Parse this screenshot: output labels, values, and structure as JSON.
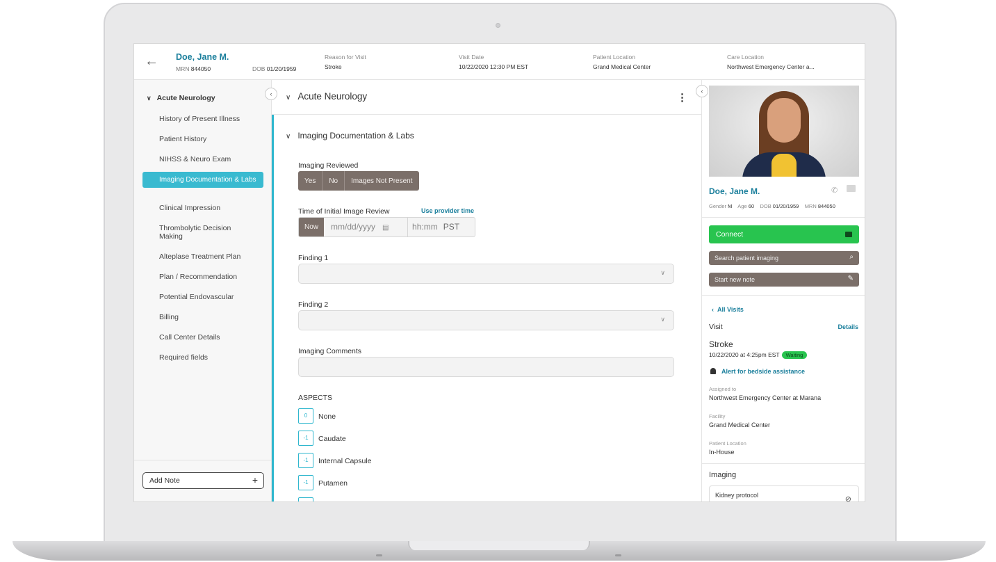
{
  "header": {
    "patient_name": "Doe, Jane M.",
    "mrn_label": "MRN",
    "mrn_value": "844050",
    "dob_label": "DOB",
    "dob_value": "01/20/1959",
    "reason_label": "Reason for Visit",
    "reason_value": "Stroke",
    "visit_date_label": "Visit Date",
    "visit_date_value": "10/22/2020 12:30 PM EST",
    "patient_location_label": "Patient Location",
    "patient_location_value": "Grand Medical Center",
    "care_location_label": "Care Location",
    "care_location_value": "Northwest Emergency Center a..."
  },
  "nav": {
    "section": "Acute Neurology",
    "items": [
      "History of Present Illness",
      "Patient History",
      "NIHSS & Neuro Exam",
      "Imaging Documentation & Labs",
      "Clinical Impression",
      "Thrombolytic Decision Making",
      "Alteplase Treatment Plan",
      "Plan / Recommendation",
      "Potential Endovascular",
      "Billing",
      "Call Center Details",
      "Required fields"
    ],
    "active_index": 3,
    "add_note": "Add Note"
  },
  "main": {
    "title": "Acute Neurology",
    "subtitle": "Imaging Documentation & Labs",
    "imaging_reviewed_label": "Imaging Reviewed",
    "imaging_options": [
      "Yes",
      "No",
      "Images Not Present"
    ],
    "time_label": "Time of Initial Image Review",
    "use_provider_time": "Use provider time",
    "now_label": "Now",
    "date_placeholder": "mm/dd/yyyy",
    "time_placeholder": "hh:mm",
    "timezone": "PST",
    "finding1_label": "Finding 1",
    "finding2_label": "Finding 2",
    "comments_label": "Imaging Comments",
    "aspects_label": "ASPECTS",
    "aspects": [
      {
        "score": "0",
        "label": "None"
      },
      {
        "score": "-1",
        "label": "Caudate"
      },
      {
        "score": "-1",
        "label": "Internal Capsule"
      },
      {
        "score": "-1",
        "label": "Putamen"
      }
    ]
  },
  "right": {
    "name": "Doe, Jane M.",
    "gender_label": "Gender",
    "gender": "M",
    "age_label": "Age",
    "age": "60",
    "dob_label": "DOB",
    "dob": "01/20/1959",
    "mrn_label": "MRN",
    "mrn": "844050",
    "connect": "Connect",
    "search_imaging": "Search patient imaging",
    "start_note": "Start new note",
    "all_visits": "All Visits",
    "visit_label": "Visit",
    "details": "Details",
    "visit_reason": "Stroke",
    "visit_time": "10/22/2020 at 4:25pm EST",
    "status": "Waiting",
    "alert": "Alert for bedside assistance",
    "assigned_label": "Assigned to",
    "assigned_value": "Northwest Emergency Center at Marana",
    "facility_label": "Facility",
    "facility_value": "Grand Medical Center",
    "location_label": "Patient Location",
    "location_value": "In-House",
    "imaging_title": "Imaging",
    "imaging_card_title": "Kidney protocol"
  },
  "colors": {
    "accent": "#2fb7ce",
    "link": "#1b7f9c",
    "connect": "#28c44f",
    "button_gray": "#7b6f69"
  }
}
